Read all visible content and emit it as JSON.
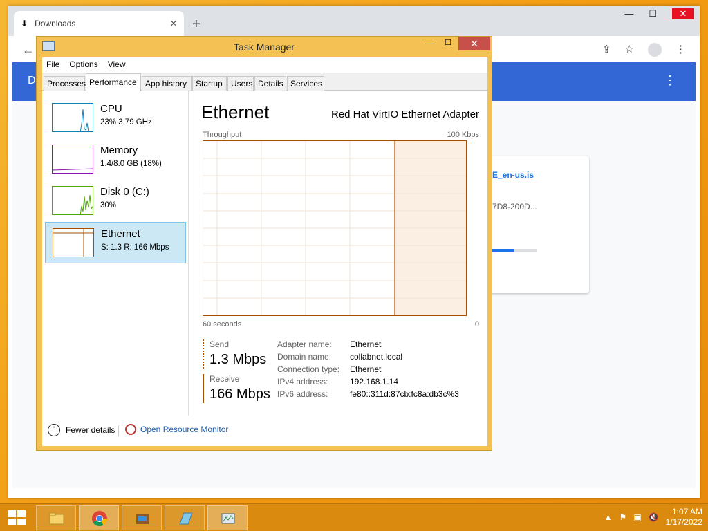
{
  "chrome": {
    "tab_title": "Downloads",
    "tab_close": "✕",
    "newtab": "+",
    "header_letter": "D",
    "download_file": "E_en-us.is",
    "download_url": "7D8-200D...",
    "download_progress": 0.5
  },
  "taskmgr": {
    "title": "Task Manager",
    "menu": [
      "File",
      "Options",
      "View"
    ],
    "tabs": [
      "Processes",
      "Performance",
      "App history",
      "Startup",
      "Users",
      "Details",
      "Services"
    ],
    "active_tab": "Performance",
    "resources": [
      {
        "name": "CPU",
        "sub": "23%  3.79 GHz",
        "color": "#117dbb"
      },
      {
        "name": "Memory",
        "sub": "1.4/8.0 GB (18%)",
        "color": "#8b12ae"
      },
      {
        "name": "Disk 0 (C:)",
        "sub": "30%",
        "color": "#4da60c"
      },
      {
        "name": "Ethernet",
        "sub": "S: 1.3  R: 166 Mbps",
        "color": "#a74f01"
      }
    ],
    "selected": "Ethernet",
    "detail": {
      "title": "Ethernet",
      "adapter": "Red Hat VirtIO Ethernet Adapter",
      "throughput_label": "Throughput",
      "max_label": "100 Kbps",
      "time_label": "60 seconds",
      "zero_label": "0",
      "send_label": "Send",
      "send_value": "1.3 Mbps",
      "receive_label": "Receive",
      "receive_value": "166 Mbps",
      "props": [
        {
          "key": "Adapter name:",
          "value": "Ethernet"
        },
        {
          "key": "Domain name:",
          "value": "collabnet.local"
        },
        {
          "key": "Connection type:",
          "value": "Ethernet"
        },
        {
          "key": "IPv4 address:",
          "value": "192.168.1.14"
        },
        {
          "key": "IPv6 address:",
          "value": "fe80::311d:87cb:fc8a:db3c%3"
        }
      ]
    },
    "footer": {
      "fewer_details": "Fewer details",
      "resource_monitor": "Open Resource Monitor"
    }
  },
  "taskbar": {
    "time": "1:07 AM",
    "date": "1/17/2022"
  }
}
